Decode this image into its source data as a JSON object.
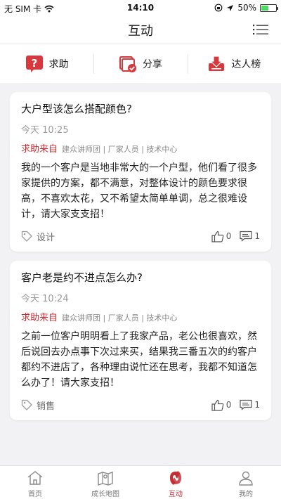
{
  "status_bar": {
    "carrier": "无 SIM 卡",
    "time": "14:10",
    "battery": "50%",
    "battery_level": 0.5
  },
  "nav": {
    "title": "互动",
    "menu_icon": "list-menu-icon"
  },
  "quick_actions": [
    {
      "label": "求助",
      "icon": "help-question-icon",
      "color": "#d7373d"
    },
    {
      "label": "分享",
      "icon": "share-icon",
      "color": "#d7373d"
    },
    {
      "label": "达人榜",
      "icon": "ranking-download-icon",
      "color": "#d7373d"
    }
  ],
  "posts": [
    {
      "title": "大户型该怎么搭配颜色?",
      "time": "今天 10:25",
      "from_label": "求助来自",
      "orgs": "建众讲师团 | 厂家人员 | 技术中心",
      "body": "我的一个客户是当地非常大的一个户型，他们看了很多家提供的方案，都不满意，对整体设计的颜色要求很高，不喜欢太花，又不希望太简单单调，总之很难设计，请大家支支招！",
      "tag": "设计",
      "likes": "0",
      "comments": "1"
    },
    {
      "title": "客户老是约不进点怎么办?",
      "time": "今天 10:24",
      "from_label": "求助来自",
      "orgs": "建众讲师团 | 厂家人员 | 技术中心",
      "body": "之前一位客户明明看上了我家产品，老公也很喜欢，然后说回去办点事下次过来买，结果我三番五次的约客户都约不进店了，各种理由说忙还在思考，我都不知道怎么办了！请大家支招！",
      "tag": "销售",
      "likes": "0",
      "comments": "1"
    }
  ],
  "tabs": [
    {
      "label": "首页",
      "icon": "home-icon"
    },
    {
      "label": "成长地图",
      "icon": "map-icon"
    },
    {
      "label": "互动",
      "icon": "interaction-logo-icon"
    },
    {
      "label": "我的",
      "icon": "profile-icon"
    }
  ],
  "colors": {
    "accent": "#c62d33",
    "background": "#f2f2f4"
  }
}
